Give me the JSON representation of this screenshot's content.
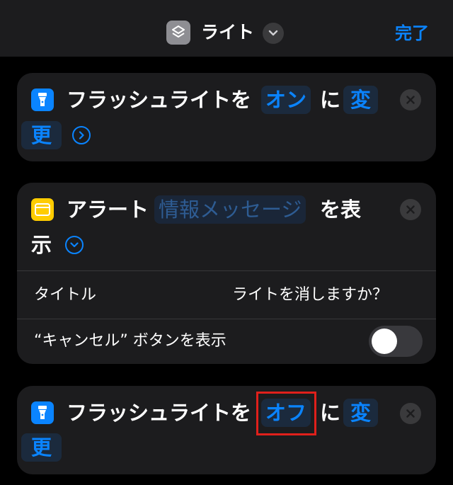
{
  "header": {
    "title": "ライト",
    "done_label": "完了",
    "app_icon": "shortcuts-icon",
    "menu_icon": "chevron-down-icon"
  },
  "actions": [
    {
      "icon": "flashlight-icon",
      "prefix": "フラッシュライトを",
      "param": "オン",
      "connector": "に",
      "verb_line1": "変",
      "verb_line2": "更",
      "expand_icon": "chevron-right-icon"
    },
    {
      "icon": "alert-icon",
      "prefix": "アラート",
      "param": "情報メッセージ",
      "suffix_line1": "を表",
      "suffix_line2": "示",
      "expand_icon": "chevron-down-icon",
      "rows": [
        {
          "label": "タイトル",
          "value": "ライトを消しますか？"
        },
        {
          "label": "“キャンセル” ボタンを表示",
          "toggle": false
        }
      ]
    },
    {
      "icon": "flashlight-icon",
      "prefix": "フラッシュライトを",
      "param": "オフ",
      "connector": "に",
      "verb_line1": "変",
      "verb_line2": "更"
    }
  ],
  "colors": {
    "accent": "#0a84ff",
    "card_bg": "#1c1c1e",
    "highlight": "#e0201b",
    "alert_icon": "#ffcc00"
  }
}
